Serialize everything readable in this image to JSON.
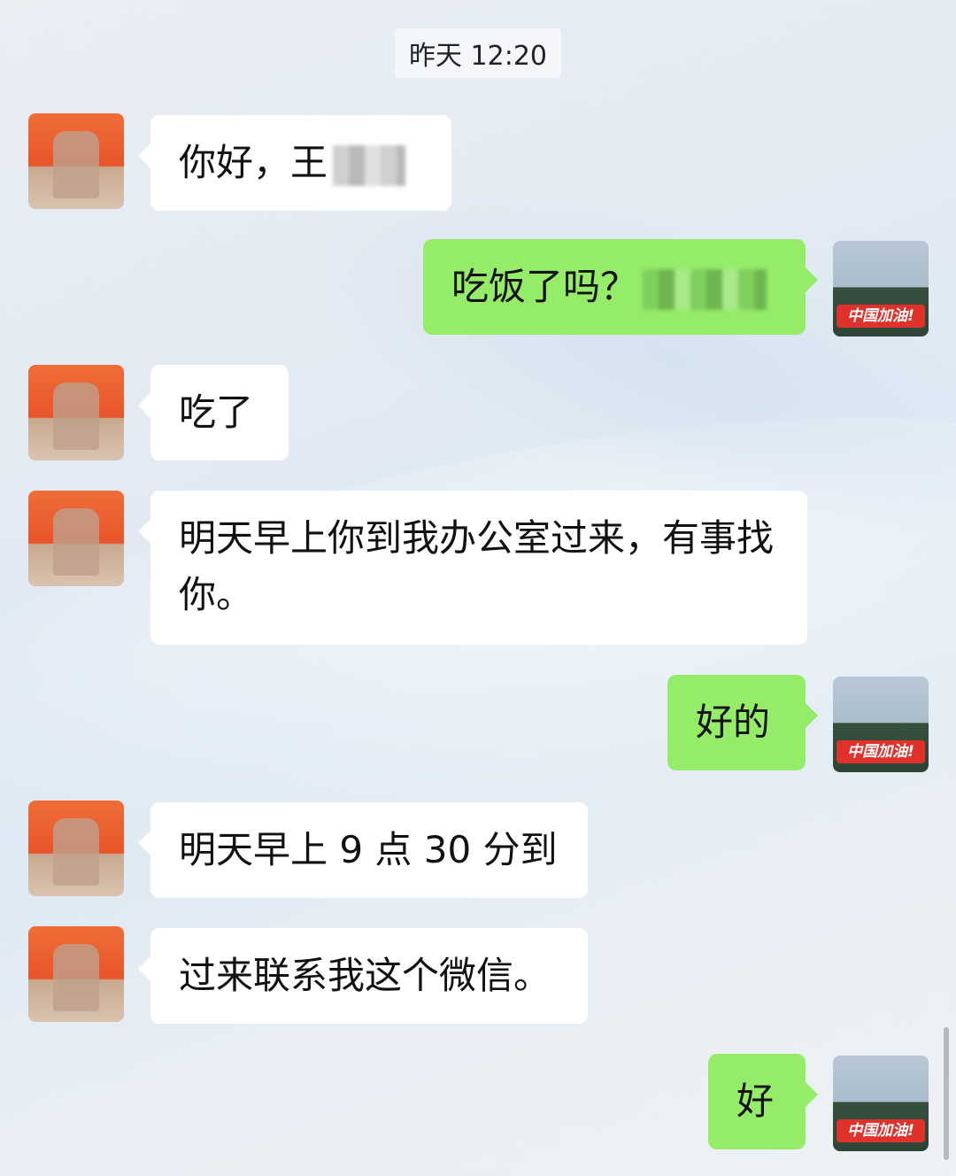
{
  "timestamp": "昨天 12:20",
  "messages": [
    {
      "from": "other",
      "text": "你好，王"
    },
    {
      "from": "me",
      "text": "吃饭了吗？"
    },
    {
      "from": "other",
      "text": "吃了"
    },
    {
      "from": "other",
      "text": "明天早上你到我办公室过来，有事找你。"
    },
    {
      "from": "me",
      "text": "好的"
    },
    {
      "from": "other",
      "text": "明天早上 9 点 30 分到"
    },
    {
      "from": "other",
      "text": "过来联系我这个微信。"
    },
    {
      "from": "me",
      "text": "好"
    }
  ],
  "my_avatar_badge": "中国加油!",
  "colors": {
    "outgoing_bubble": "#95ec69",
    "incoming_bubble": "#ffffff",
    "badge": "#e0322a"
  },
  "icons": {
    "other_avatar": "blurred-person-avatar",
    "my_avatar": "mountain-landscape-avatar"
  }
}
